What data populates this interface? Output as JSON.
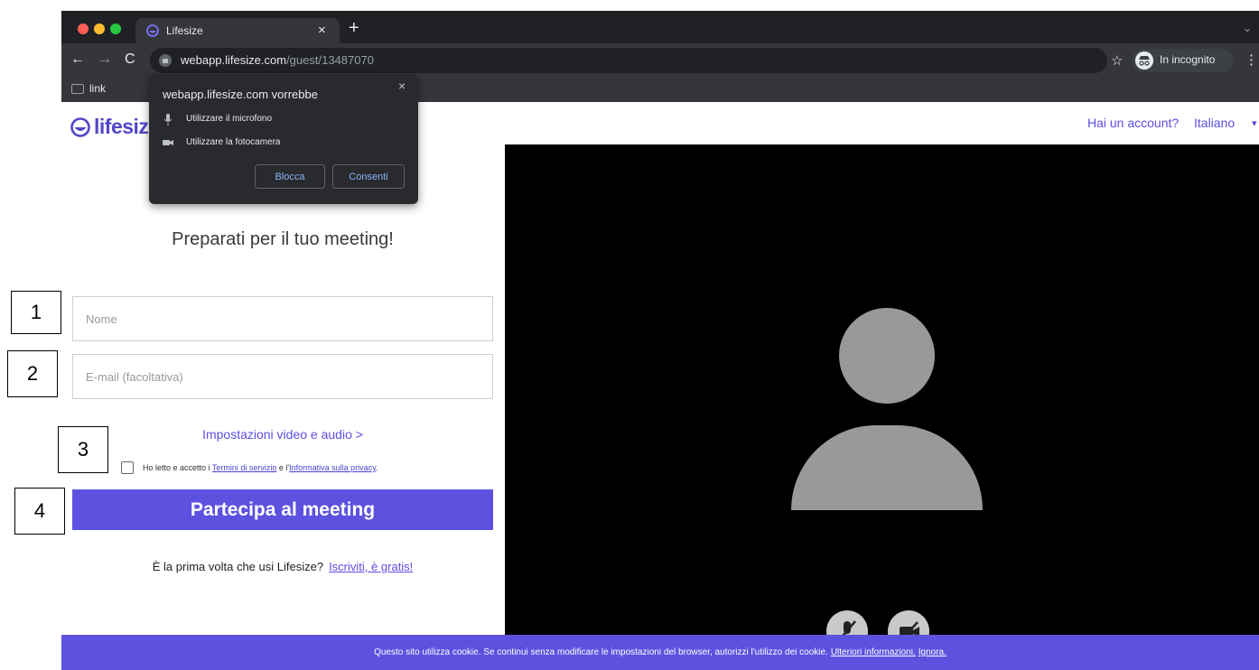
{
  "browser": {
    "tab_title": "Lifesize",
    "tab_close": "×",
    "new_tab": "+",
    "tabs_menu": "⌄",
    "nav_back": "←",
    "nav_forward": "→",
    "nav_reload": "C",
    "url_host": "webapp.lifesize.com",
    "url_path": "/guest/13487070",
    "bookmark_star": "☆",
    "incognito_label": "In incognito",
    "menu": "⋮",
    "bookmarks": [
      {
        "label": "link"
      }
    ]
  },
  "permission_popup": {
    "title": "webapp.lifesize.com vorrebbe",
    "close": "×",
    "items": [
      {
        "label": "Utilizzare il microfono",
        "icon": "microphone-icon"
      },
      {
        "label": "Utilizzare la fotocamera",
        "icon": "camera-icon"
      }
    ],
    "block_label": "Blocca",
    "allow_label": "Consenti"
  },
  "header": {
    "logo_text": "lifesize",
    "account_link": "Hai un account?",
    "language": "Italiano",
    "language_caret": "▾"
  },
  "form": {
    "title": "Preparati per il tuo meeting!",
    "name_placeholder": "Nome",
    "email_placeholder": "E-mail (facoltativa)",
    "av_settings": "Impostazioni video e audio >",
    "consent_prefix": "Ho letto e accetto i ",
    "terms_link": "Termini di servizio",
    "consent_middle": " e l'",
    "privacy_link": "Informativa sulla privacy",
    "consent_suffix": ".",
    "join_button": "Partecipa al meeting",
    "first_time": "È la prima volta che usi Lifesize?",
    "signup_link": "Iscriviti, è gratis!"
  },
  "video_controls": {
    "mic_icon": "microphone-muted-icon",
    "camera_icon": "camera-off-icon"
  },
  "cookie_bar": {
    "text": "Questo sito utilizza cookie. Se continui senza modificare le impostazioni del browser, autorizzi l'utilizzo dei cookie.",
    "more_info": "Ulteriori informazioni.",
    "ignore": "Ignora."
  },
  "annotations": [
    "1",
    "2",
    "3",
    "4"
  ],
  "colors": {
    "brand": "#5d52e0",
    "chrome_dark": "#202124",
    "toolbar": "#35363a",
    "avatar_gray": "#999999"
  }
}
